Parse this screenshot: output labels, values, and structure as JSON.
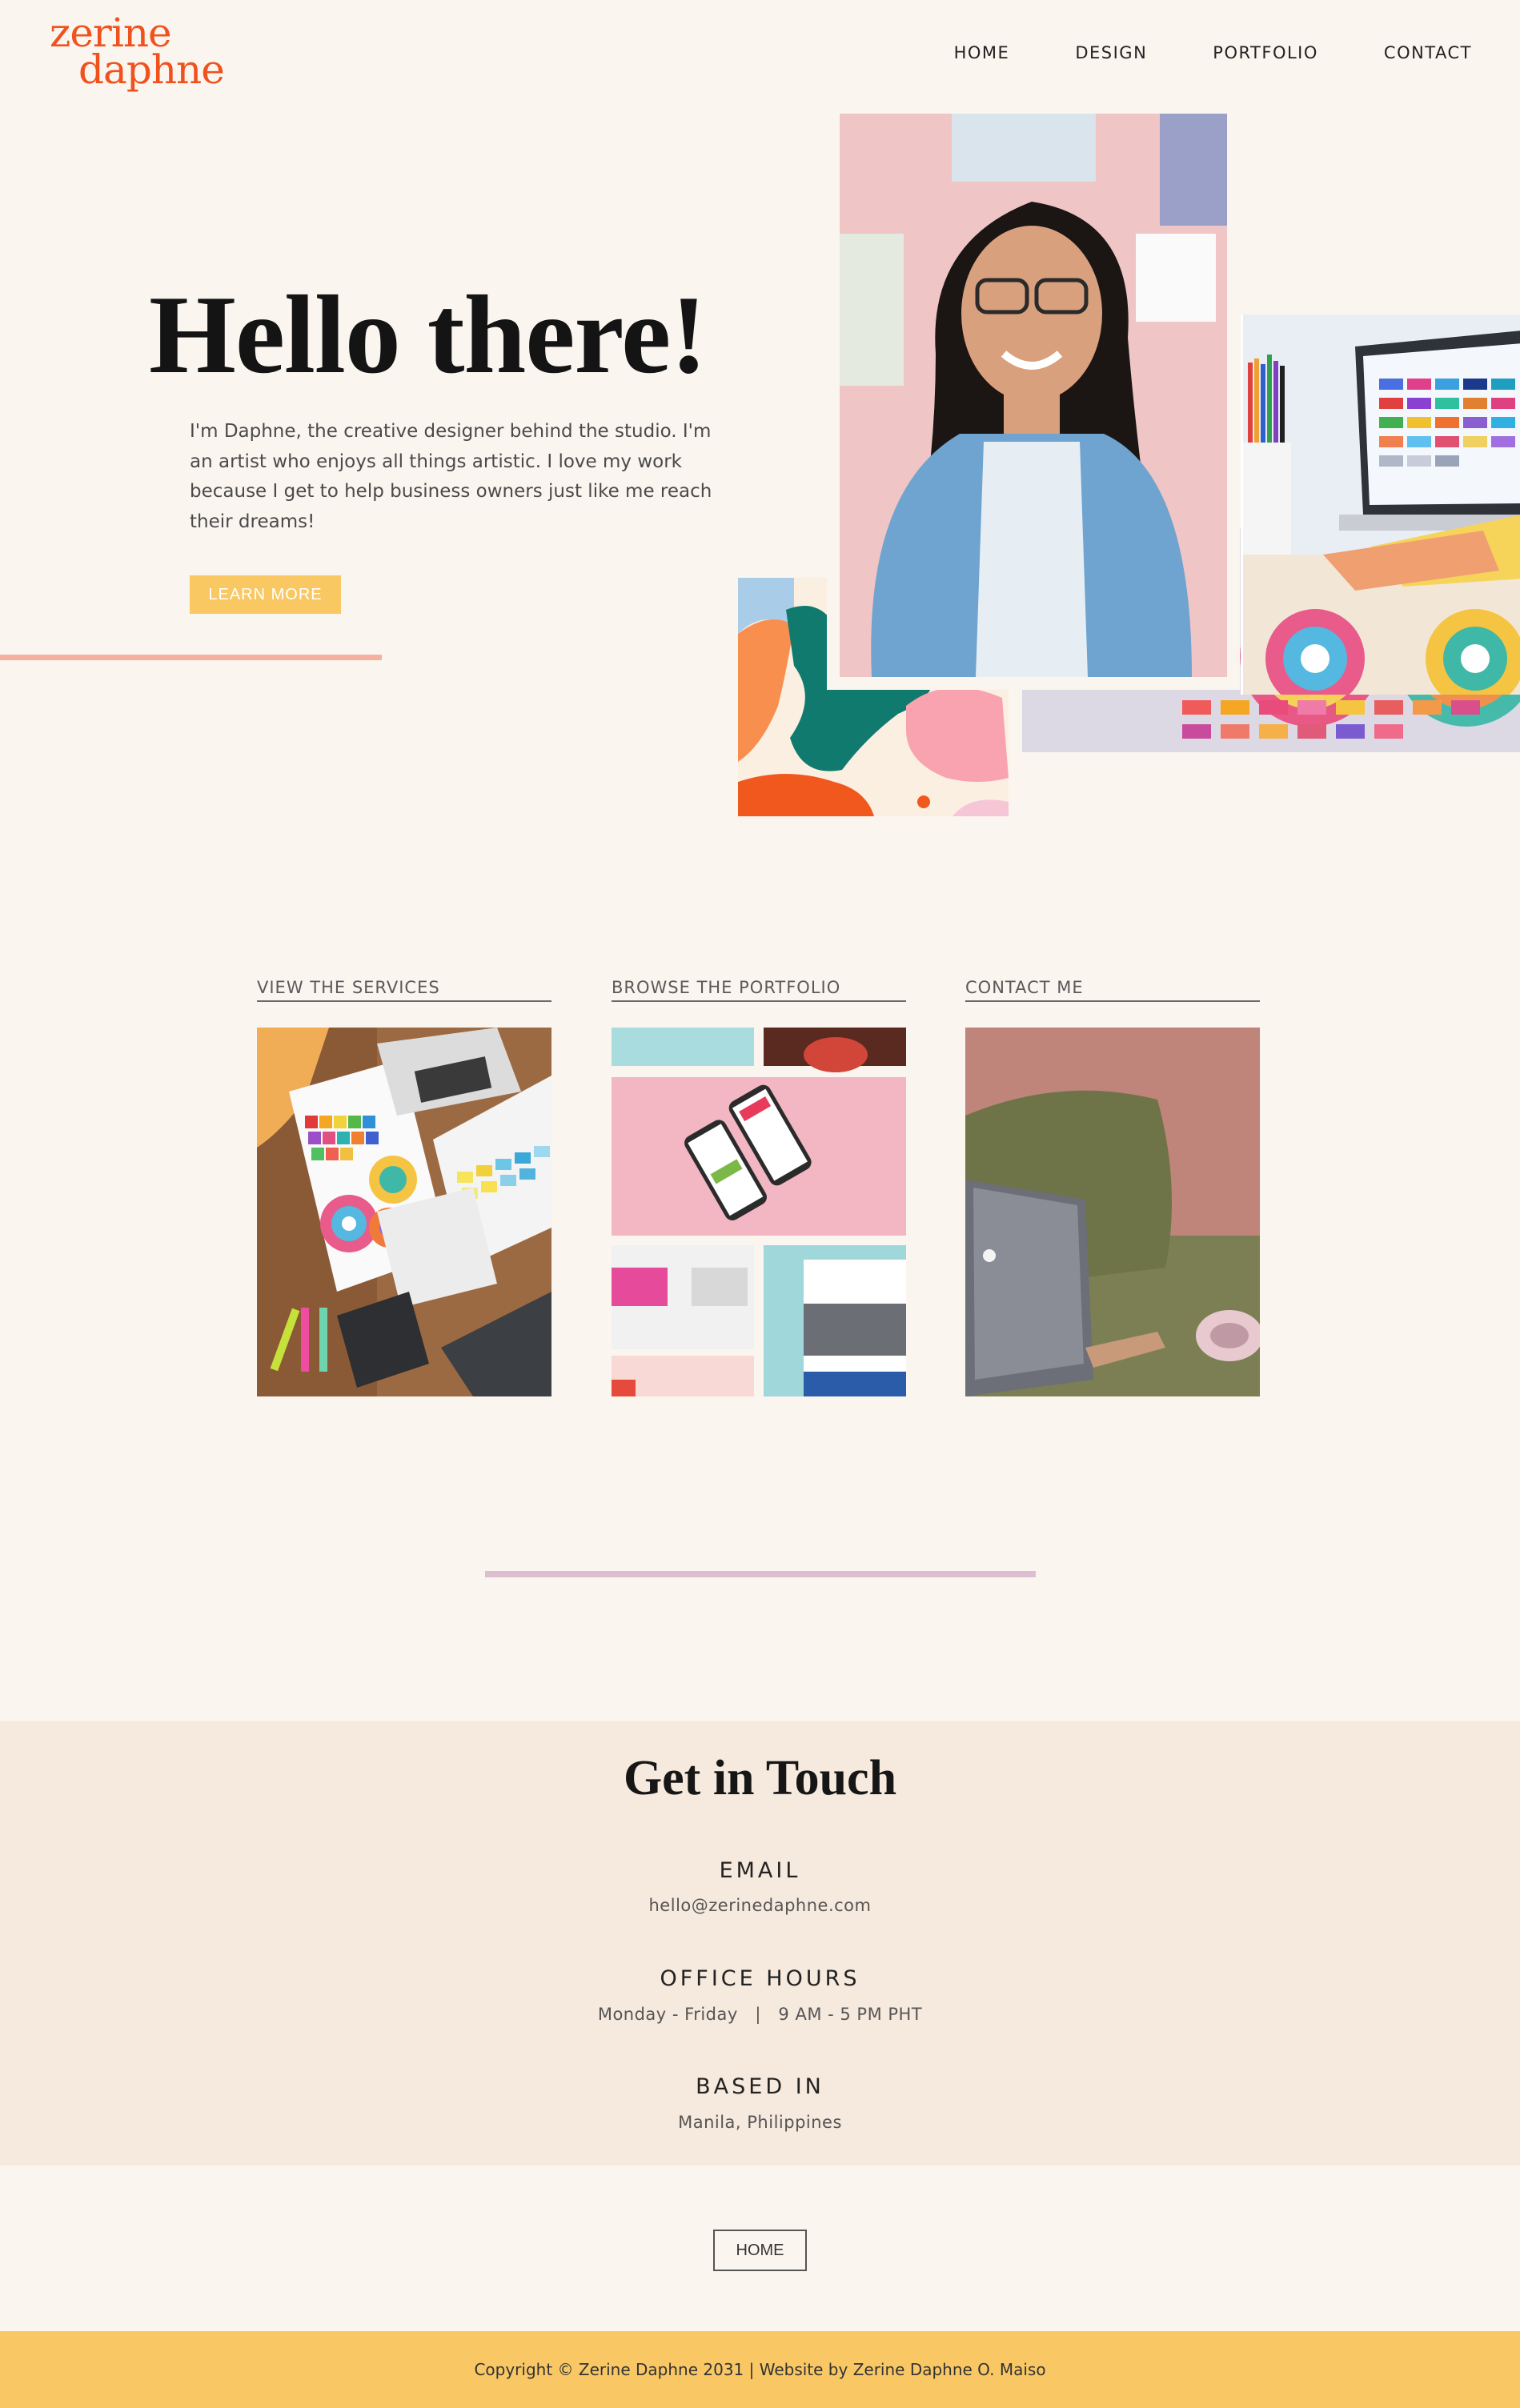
{
  "brand": {
    "logo_line1": "zerine",
    "logo_line2": "daphne"
  },
  "nav": [
    {
      "label": "HOME"
    },
    {
      "label": "DESIGN"
    },
    {
      "label": "PORTFOLIO"
    },
    {
      "label": "CONTACT"
    }
  ],
  "hero": {
    "title": "Hello there!",
    "text": "I'm Daphne, the creative designer behind the studio. I'm an artist who enjoys all things artistic. I love my work because I get to help business owners just like me reach their dreams!",
    "button": "LEARN MORE"
  },
  "cards": [
    {
      "label": "VIEW THE SERVICES"
    },
    {
      "label": "BROWSE THE PORTFOLIO"
    },
    {
      "label": "CONTACT ME"
    }
  ],
  "contact": {
    "title": "Get in Touch",
    "email_heading": "EMAIL",
    "email_value": "hello@zerinedaphne.com",
    "hours_heading": "OFFICE HOURS",
    "hours_value": "Monday - Friday   |   9 AM - 5 PM PHT",
    "based_heading": "BASED IN",
    "based_value": "Manila, Philippines"
  },
  "home_button": "HOME",
  "footer": {
    "copyright": "Copyright © Zerine Daphne 2031 | Website by Zerine Daphne O. Maiso"
  },
  "colors": {
    "background": "#fbf5ef",
    "accent_orange": "#f0521e",
    "accent_yellow": "#f9c863",
    "band": "#f6e9dd",
    "pink_line": "#ddbdd0",
    "salmon_line": "#f6b09f"
  }
}
